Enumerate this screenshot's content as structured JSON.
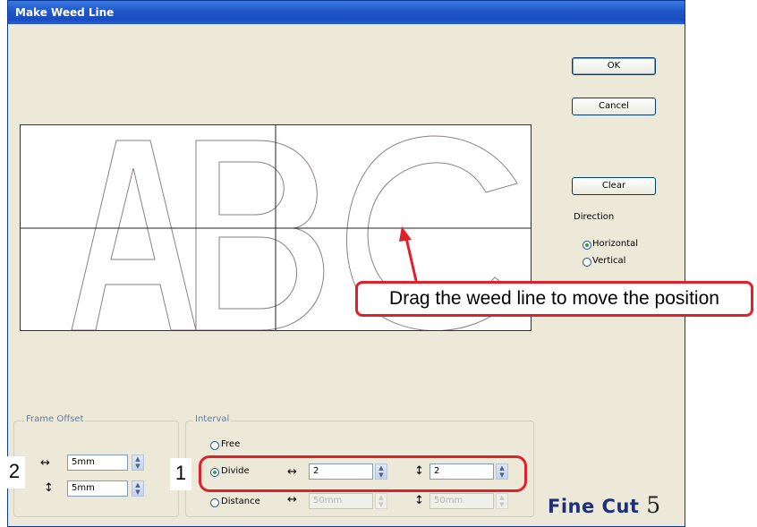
{
  "window": {
    "title": "Make Weed Line"
  },
  "buttons": {
    "ok": "OK",
    "cancel": "Cancel",
    "clear": "Clear"
  },
  "direction": {
    "label": "Direction",
    "options": [
      {
        "label": "Horizontal",
        "selected": true
      },
      {
        "label": "Vertical",
        "selected": false
      }
    ]
  },
  "preview": {
    "letters": "ABC"
  },
  "callout": {
    "text": "Drag the weed line to move the position"
  },
  "frame_offset": {
    "label": "Frame Offset",
    "horizontal_value": "5mm",
    "vertical_value": "5mm"
  },
  "interval": {
    "label": "Interval",
    "options": [
      {
        "label": "Free",
        "selected": false
      },
      {
        "label": "Divide",
        "selected": true
      },
      {
        "label": "Distance",
        "selected": false
      }
    ],
    "divide_horizontal": "2",
    "divide_vertical": "2",
    "distance_horizontal": "50mm",
    "distance_vertical": "50mm"
  },
  "steps": {
    "one": "1",
    "two": "2"
  },
  "logo": {
    "text": "Fine Cut",
    "version": "5"
  },
  "icons": {
    "horizontal_arrow": "↔",
    "vertical_arrow": "↕",
    "spin_up": "▲",
    "spin_down": "▼"
  },
  "colors": {
    "title_bar": "#1f56c8",
    "callout": "#e0202a",
    "dialog_bg": "#ece9d8"
  }
}
